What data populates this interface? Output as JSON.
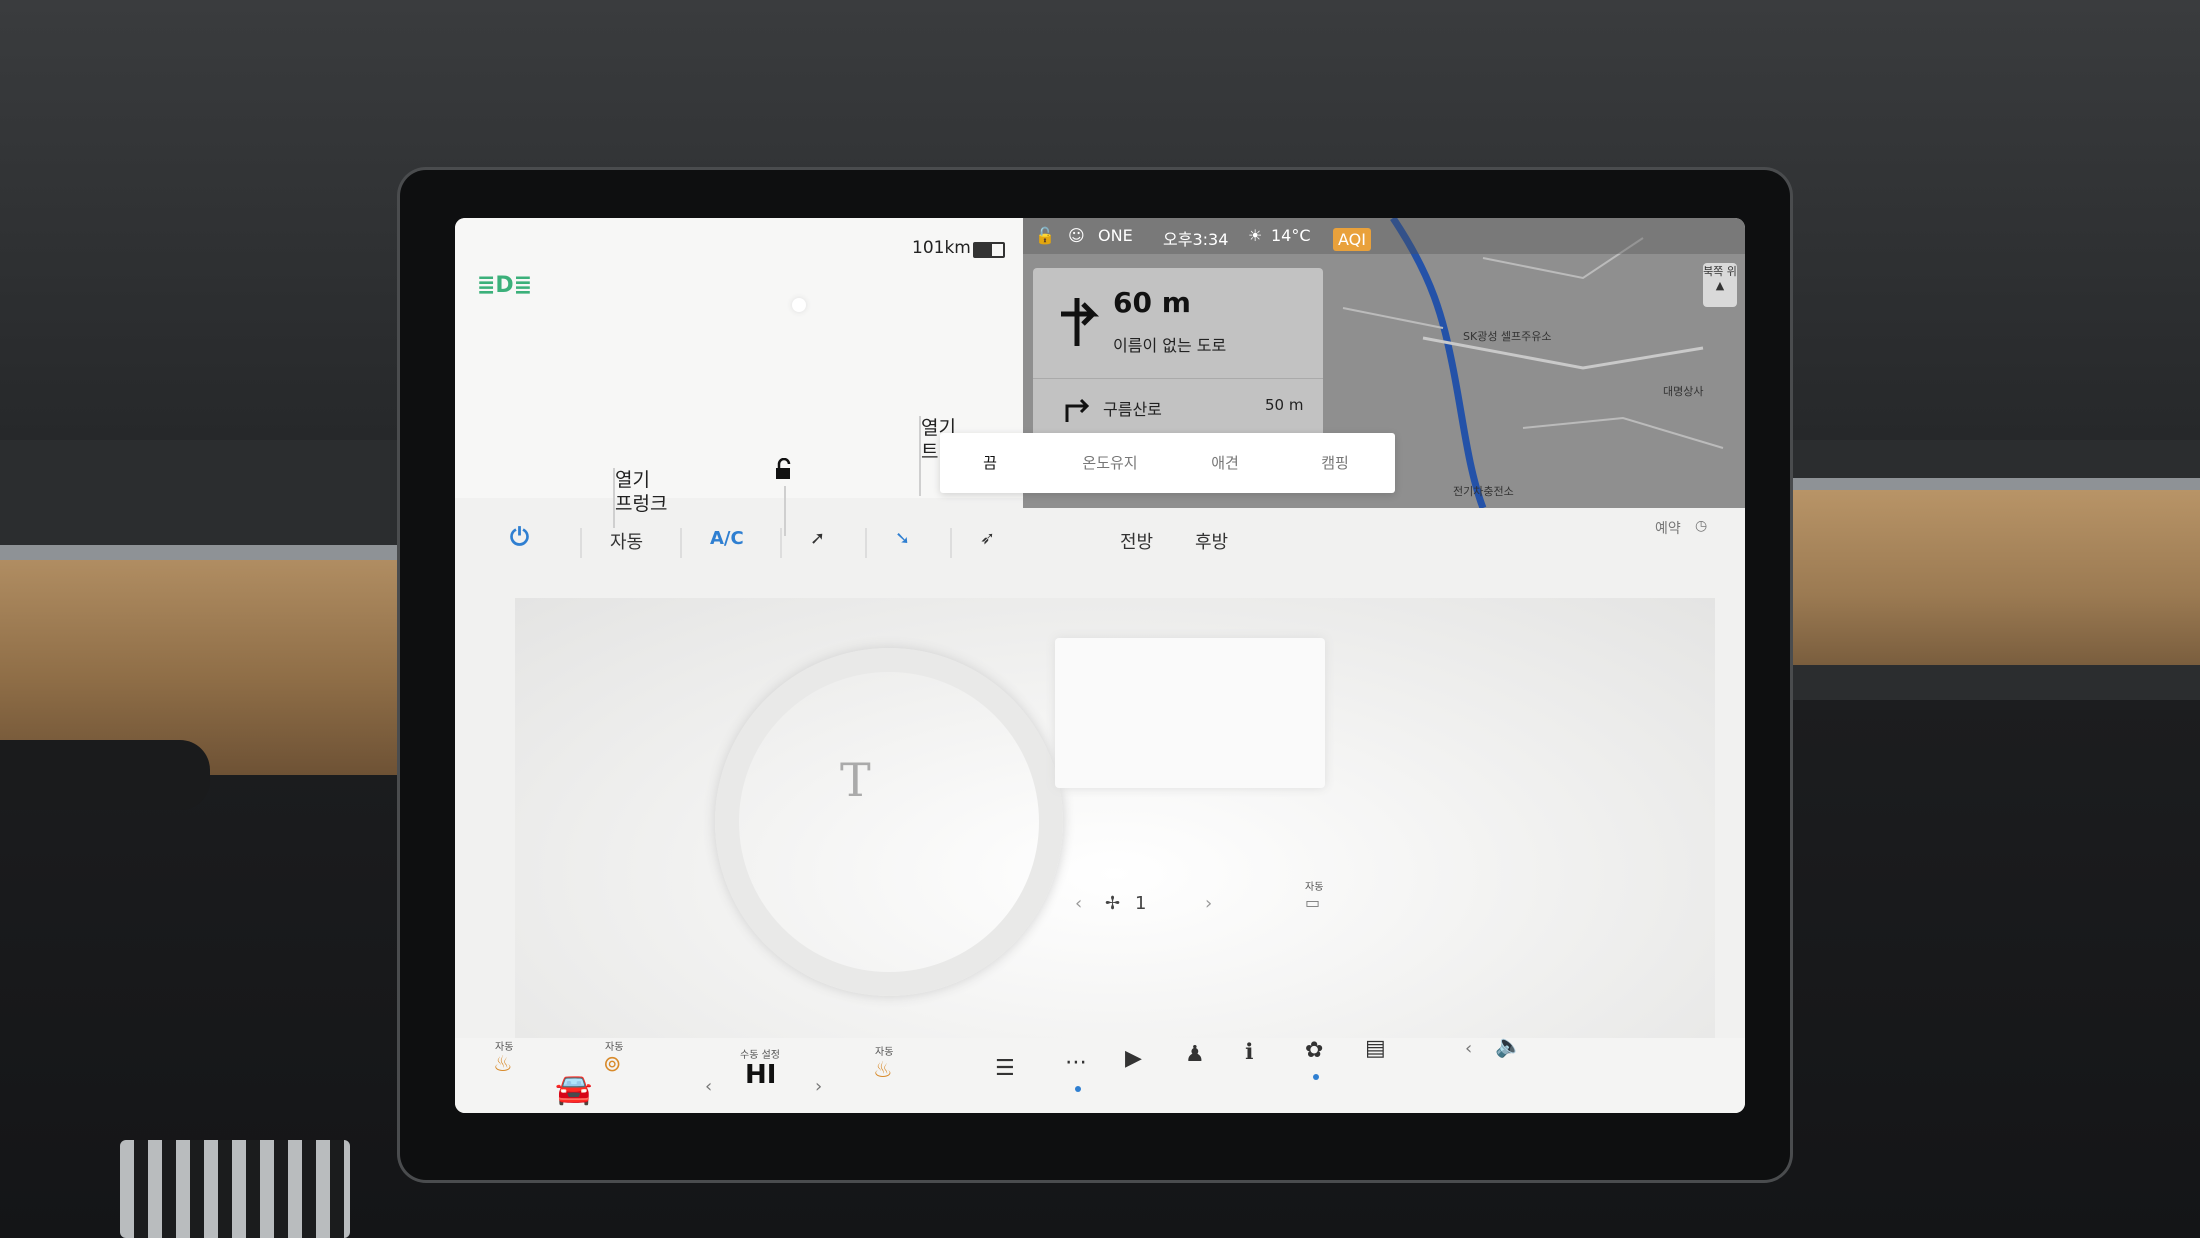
{
  "vehicle": {
    "range": "101km",
    "frunk_label_top": "열기",
    "frunk_label_bottom": "프렁크",
    "trunk_label_top": "열기",
    "trunk_label_bottom": "트"
  },
  "status_bar": {
    "profile": "ONE",
    "time": "오후3:34",
    "temperature": "14°C",
    "aqi": "AQI"
  },
  "navigation": {
    "distance": "60 m",
    "road": "이름이 없는 도로",
    "next_road": "구름산로",
    "next_distance": "50 m",
    "compass": "북쪽 위"
  },
  "map": {
    "poi_1": "SK광성 셀프주유소",
    "poi_2": "전기차충전소",
    "poi_3": "대명상사"
  },
  "climate_modes": [
    "끔",
    "온도유지",
    "애견",
    "캠핑"
  ],
  "climate": {
    "auto": "자동",
    "ac": "A/C",
    "front": "전방",
    "rear": "후방",
    "schedule": "예약",
    "fan_speed": "1",
    "rear_seat_auto": "자동"
  },
  "dock": {
    "seat_auto_left": "자동",
    "wheel_auto": "자동",
    "temp_mode": "수동 설정",
    "temp_value": "HI",
    "seat_auto_right": "자동"
  },
  "colors": {
    "accent_blue": "#2f7fd1",
    "headlight_green": "#3bb07a",
    "aqi_orange": "#e9a13b"
  }
}
